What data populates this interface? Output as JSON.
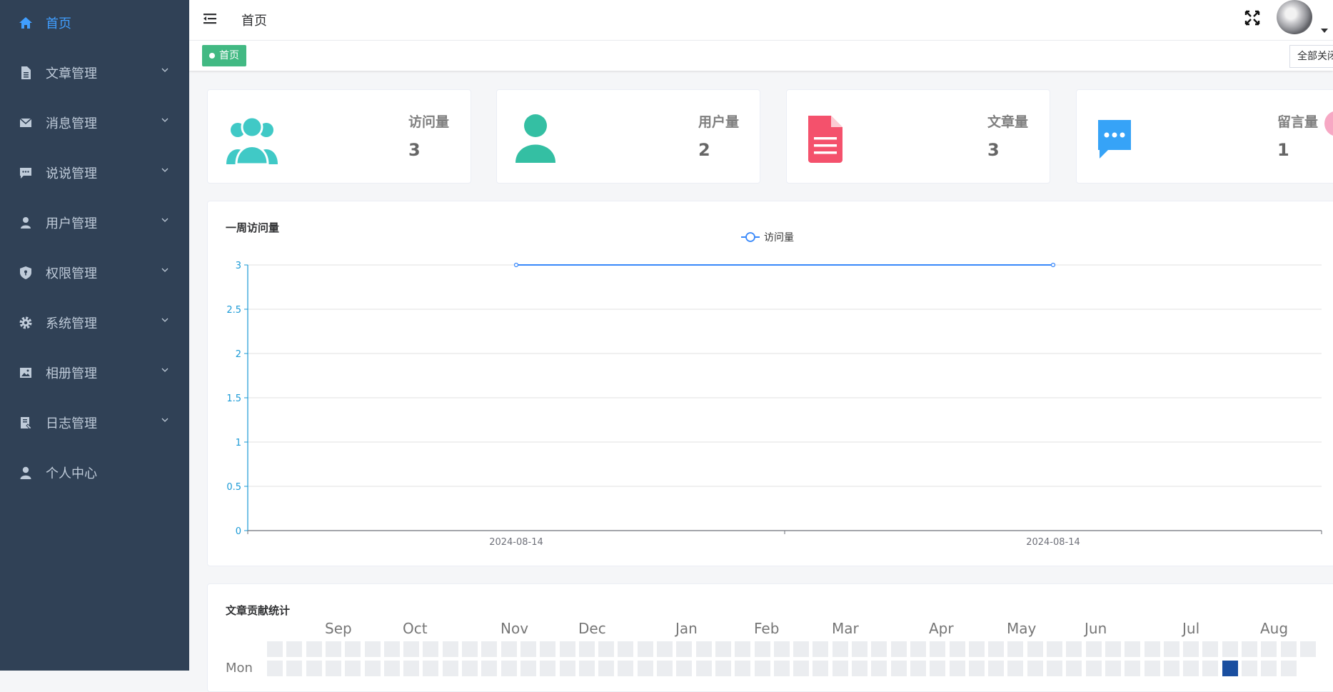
{
  "sidebar": {
    "items": [
      {
        "label": "首页",
        "icon": "home-icon",
        "active": true
      },
      {
        "label": "文章管理",
        "icon": "document-icon"
      },
      {
        "label": "消息管理",
        "icon": "envelope-icon"
      },
      {
        "label": "说说管理",
        "icon": "chat-icon"
      },
      {
        "label": "用户管理",
        "icon": "user-icon"
      },
      {
        "label": "权限管理",
        "icon": "shield-icon"
      },
      {
        "label": "系统管理",
        "icon": "gear-icon"
      },
      {
        "label": "相册管理",
        "icon": "image-icon"
      },
      {
        "label": "日志管理",
        "icon": "log-icon"
      },
      {
        "label": "个人中心",
        "icon": "person-icon"
      }
    ]
  },
  "header": {
    "breadcrumb": "首页"
  },
  "tags": {
    "active_tag": "首页",
    "close_all": "全部关闭"
  },
  "stats": [
    {
      "title": "访问量",
      "value": "3",
      "color": "#40c9c6",
      "icon": "users-icon"
    },
    {
      "title": "用户量",
      "value": "2",
      "color": "#34bfa3",
      "icon": "user-icon"
    },
    {
      "title": "文章量",
      "value": "3",
      "color": "#f4516c",
      "icon": "document-icon"
    },
    {
      "title": "留言量",
      "value": "1",
      "color": "#36a3f7",
      "icon": "message-icon"
    }
  ],
  "visit_chart": {
    "title": "一周访问量"
  },
  "chart_data": {
    "type": "line",
    "title": "一周访问量",
    "categories": [
      "2024-08-14",
      "2024-08-14"
    ],
    "series": [
      {
        "name": "访问量",
        "values": [
          3,
          3
        ]
      }
    ],
    "ylim": [
      0,
      3
    ],
    "yticks": [
      "0",
      "0.5",
      "1",
      "1.5",
      "2",
      "2.5",
      "3"
    ],
    "grid": true,
    "legend": "top-center",
    "color": "#3888fa"
  },
  "heatmap": {
    "title": "文章贡献统计",
    "months": [
      "Sep",
      "Oct",
      "Nov",
      "Dec",
      "Jan",
      "Feb",
      "Mar",
      "Apr",
      "May",
      "Jun",
      "Jul",
      "Aug"
    ],
    "weekday": "Mon"
  }
}
